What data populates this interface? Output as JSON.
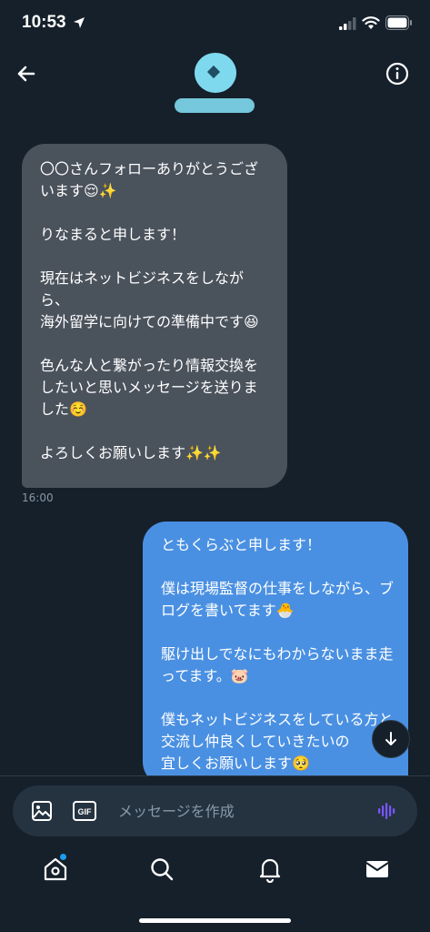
{
  "status_bar": {
    "time": "10:53"
  },
  "conversation": {
    "incoming_message": "〇〇さんフォローありがとうございます😌✨\n\nりなまると申します！\n\n現在はネットビジネスをしながら、\n海外留学に向けての準備中です😆\n\n色んな人と繋がったり情報交換をしたいと思いメッセージを送りました☺️\n\nよろしくお願いします✨✨",
    "incoming_time": "16:00",
    "outgoing_message": "ともくらぶと申します！\n\n僕は現場監督の仕事をしながら、ブログを書いてます🐣\n\n駆け出しでなにもわからないまま走ってます。🐷\n\n僕もネットビジネスをしている方と交流し仲良くしていきたいの\n宜しくお願いします🥺"
  },
  "composer": {
    "placeholder": "メッセージを作成",
    "gif_label": "GIF"
  },
  "colors": {
    "background": "#15202b",
    "incoming_bubble": "#4a525c",
    "outgoing_bubble": "#4a90e2",
    "accent": "#1d9bf0",
    "voice_icon": "#7856ff"
  },
  "icons": [
    "back-arrow-icon",
    "info-icon",
    "image-icon",
    "gif-icon",
    "voice-wave-icon",
    "home-icon",
    "search-icon",
    "bell-icon",
    "mail-icon",
    "arrow-down-icon"
  ]
}
